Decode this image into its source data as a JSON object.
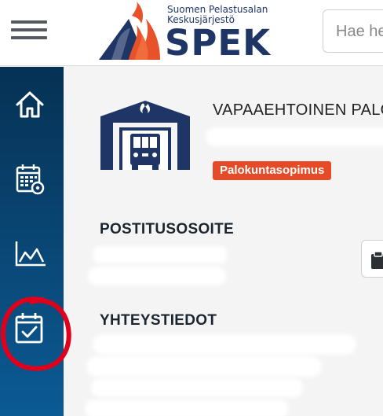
{
  "header": {
    "logo_line1": "Suomen Pelastusalan",
    "logo_line2": "Keskusjärjestö",
    "logo_word": "SPEK",
    "search_placeholder": "Hae he"
  },
  "sidebar": {
    "items": [
      {
        "name": "home",
        "icon": "home-icon"
      },
      {
        "name": "calendar-settings",
        "icon": "calendar-gear-icon"
      },
      {
        "name": "statistics",
        "icon": "area-chart-icon"
      },
      {
        "name": "tasks",
        "icon": "calendar-check-icon"
      }
    ]
  },
  "main": {
    "org_name": "VAPAAEHTOINEN PALO",
    "badge": "Palokuntasopimus",
    "postal_title": "POSTITUSOSOITE",
    "contact_title": "YHTEYSTIEDOT"
  },
  "colors": {
    "brand_navy": "#1f3566",
    "brand_orange": "#e64a26",
    "sidebar_top": "#063154",
    "sidebar_bottom": "#0b5a94",
    "annotation_red": "#e0001b"
  }
}
